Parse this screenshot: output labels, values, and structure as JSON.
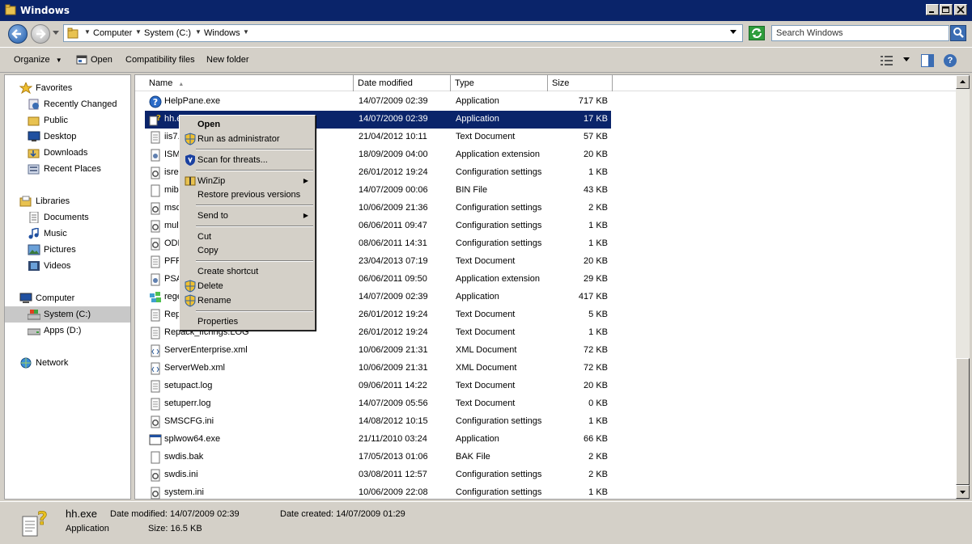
{
  "window": {
    "title": "Windows"
  },
  "address": {
    "crumbs": [
      "Computer",
      "System (C:)",
      "Windows"
    ],
    "search_placeholder": "Search Windows"
  },
  "toolbar": {
    "organize": "Organize",
    "open": "Open",
    "compat": "Compatibility files",
    "new_folder": "New folder"
  },
  "nav": {
    "favorites": "Favorites",
    "recently_changed": "Recently Changed",
    "public": "Public",
    "desktop": "Desktop",
    "downloads": "Downloads",
    "recent_places": "Recent Places",
    "libraries": "Libraries",
    "documents": "Documents",
    "music": "Music",
    "pictures": "Pictures",
    "videos": "Videos",
    "computer": "Computer",
    "system_c": "System (C:)",
    "apps_d": "Apps (D:)",
    "network": "Network"
  },
  "columns": {
    "name": "Name",
    "date": "Date modified",
    "type": "Type",
    "size": "Size"
  },
  "files": [
    {
      "name": "HelpPane.exe",
      "date": "14/07/2009 02:39",
      "type": "Application",
      "size": "717 KB",
      "icon": "help-icon"
    },
    {
      "name": "hh.e",
      "date": "14/07/2009 02:39",
      "type": "Application",
      "size": "17 KB",
      "icon": "help-doc-icon"
    },
    {
      "name": "iis7.",
      "date": "21/04/2012 10:11",
      "type": "Text Document",
      "size": "57 KB",
      "icon": "text-file-icon"
    },
    {
      "name": "ISM",
      "date": "18/09/2009 04:00",
      "type": "Application extension",
      "size": "20 KB",
      "icon": "dll-icon"
    },
    {
      "name": "isrep",
      "date": "26/01/2012 19:24",
      "type": "Configuration settings",
      "size": "1 KB",
      "icon": "config-icon"
    },
    {
      "name": "mib.",
      "date": "14/07/2009 00:06",
      "type": "BIN File",
      "size": "43 KB",
      "icon": "blank-file-icon"
    },
    {
      "name": "msd",
      "date": "10/06/2009 21:36",
      "type": "Configuration settings",
      "size": "2 KB",
      "icon": "config-icon"
    },
    {
      "name": "mult",
      "date": "06/06/2011 09:47",
      "type": "Configuration settings",
      "size": "1 KB",
      "icon": "config-icon"
    },
    {
      "name": "ODE",
      "date": "08/06/2011 14:31",
      "type": "Configuration settings",
      "size": "1 KB",
      "icon": "config-icon"
    },
    {
      "name": "PFR",
      "date": "23/04/2013 07:19",
      "type": "Text Document",
      "size": "20 KB",
      "icon": "text-file-icon"
    },
    {
      "name": "PSA",
      "date": "06/06/2011 09:50",
      "type": "Application extension",
      "size": "29 KB",
      "icon": "dll-icon"
    },
    {
      "name": "rege",
      "date": "14/07/2009 02:39",
      "type": "Application",
      "size": "417 KB",
      "icon": "regedit-icon"
    },
    {
      "name": "Rep",
      "date": "26/01/2012 19:24",
      "type": "Text Document",
      "size": "5 KB",
      "icon": "text-file-icon"
    },
    {
      "name": "Repack_ifchngs.LOG",
      "date": "26/01/2012 19:24",
      "type": "Text Document",
      "size": "1 KB",
      "icon": "text-file-icon"
    },
    {
      "name": "ServerEnterprise.xml",
      "date": "10/06/2009 21:31",
      "type": "XML Document",
      "size": "72 KB",
      "icon": "xml-icon"
    },
    {
      "name": "ServerWeb.xml",
      "date": "10/06/2009 21:31",
      "type": "XML Document",
      "size": "72 KB",
      "icon": "xml-icon"
    },
    {
      "name": "setupact.log",
      "date": "09/06/2011 14:22",
      "type": "Text Document",
      "size": "20 KB",
      "icon": "text-file-icon"
    },
    {
      "name": "setuperr.log",
      "date": "14/07/2009 05:56",
      "type": "Text Document",
      "size": "0 KB",
      "icon": "text-file-icon"
    },
    {
      "name": "SMSCFG.ini",
      "date": "14/08/2012 10:15",
      "type": "Configuration settings",
      "size": "1 KB",
      "icon": "config-icon"
    },
    {
      "name": "splwow64.exe",
      "date": "21/11/2010 03:24",
      "type": "Application",
      "size": "66 KB",
      "icon": "app-icon"
    },
    {
      "name": "swdis.bak",
      "date": "17/05/2013 01:06",
      "type": "BAK File",
      "size": "2 KB",
      "icon": "blank-file-icon"
    },
    {
      "name": "swdis.ini",
      "date": "03/08/2011 12:57",
      "type": "Configuration settings",
      "size": "2 KB",
      "icon": "config-icon"
    },
    {
      "name": "system.ini",
      "date": "10/06/2009 22:08",
      "type": "Configuration settings",
      "size": "1 KB",
      "icon": "config-icon"
    }
  ],
  "context_menu": {
    "open": "Open",
    "run_admin": "Run as administrator",
    "scan": "Scan for threats...",
    "winzip": "WinZip",
    "restore": "Restore previous versions",
    "send_to": "Send to",
    "cut": "Cut",
    "copy": "Copy",
    "create_shortcut": "Create shortcut",
    "delete": "Delete",
    "rename": "Rename",
    "properties": "Properties"
  },
  "details": {
    "filename": "hh.exe",
    "filetype": "Application",
    "date_modified": "Date modified: 14/07/2009 02:39",
    "size": "Size: 16.5 KB",
    "date_created": "Date created: 14/07/2009 01:29"
  }
}
